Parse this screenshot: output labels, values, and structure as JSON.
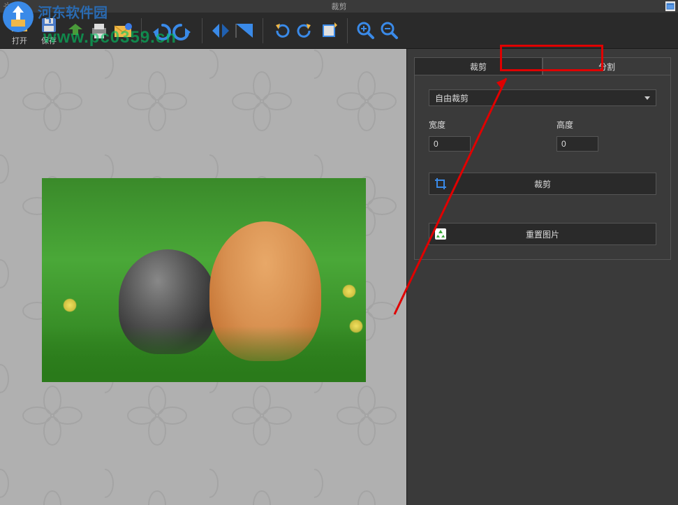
{
  "window": {
    "title": "裁剪"
  },
  "toolbar": {
    "open_label": "打开",
    "save_label": "保存"
  },
  "watermark": {
    "site_name": "河东软件园",
    "url": "www.pc0359.cn"
  },
  "tabs": {
    "crop": "裁剪",
    "split": "分割"
  },
  "panel": {
    "crop_mode": "自由裁剪",
    "width_label": "宽度",
    "height_label": "高度",
    "width_value": "0",
    "height_value": "0",
    "crop_button": "裁剪",
    "reset_button": "重置图片"
  }
}
